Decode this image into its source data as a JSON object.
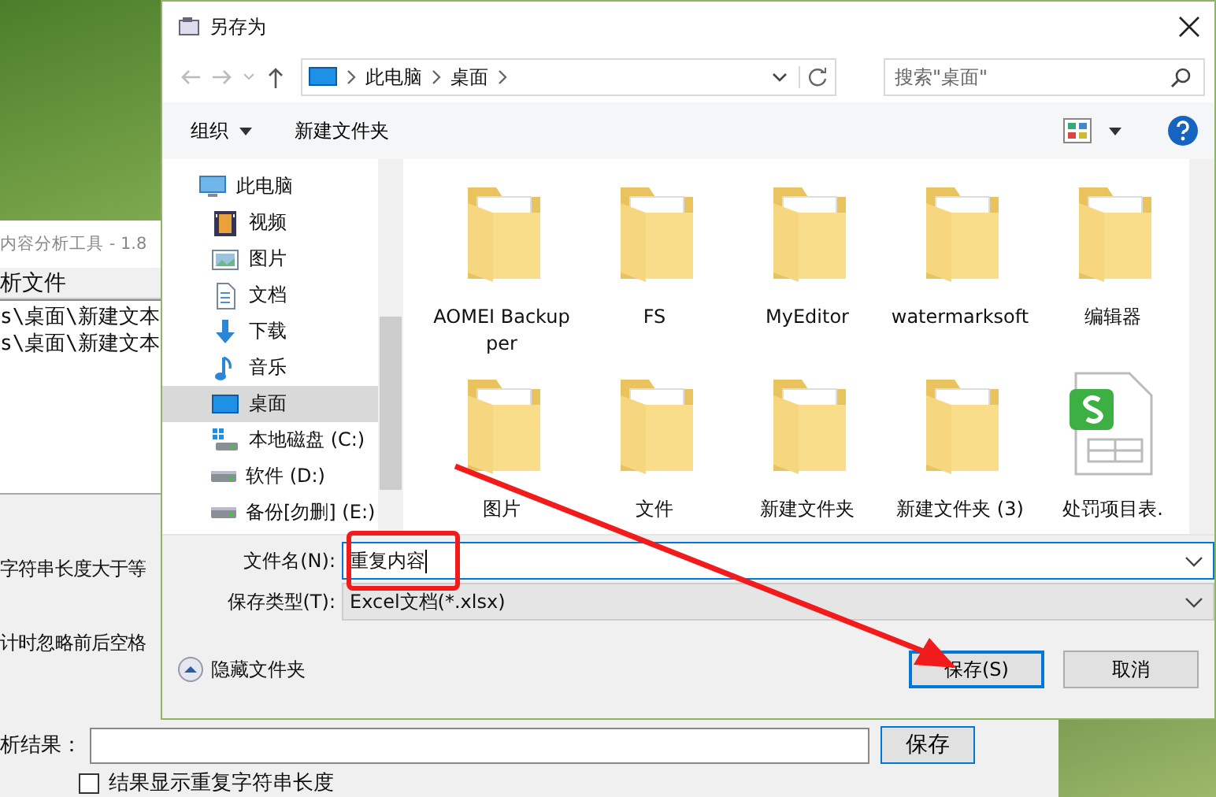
{
  "background_app": {
    "title": "内容分析工具 - 1.8",
    "group_label": "析文件",
    "file_list": [
      "s\\桌面\\新建文本",
      "s\\桌面\\新建文本"
    ],
    "options": [
      "字符串长度大于等",
      "计时忽略前后空格"
    ],
    "result_label": "析结果：",
    "save_button": "保存",
    "checkbox": {
      "label": "结果显示重复字符串长度",
      "checked": false
    }
  },
  "dialog": {
    "title": "另存为",
    "address": [
      "此电脑",
      "桌面"
    ],
    "search": {
      "placeholder": "搜索\"桌面\""
    },
    "toolbar": {
      "organize": "组织",
      "new_folder": "新建文件夹"
    },
    "nav": [
      {
        "label": "此电脑",
        "kind": "computer",
        "selected": false,
        "children": [
          {
            "label": "视频",
            "kind": "video",
            "selected": false
          },
          {
            "label": "图片",
            "kind": "pictures",
            "selected": false
          },
          {
            "label": "文档",
            "kind": "documents",
            "selected": false
          },
          {
            "label": "下载",
            "kind": "downloads",
            "selected": false
          },
          {
            "label": "音乐",
            "kind": "music",
            "selected": false
          },
          {
            "label": "桌面",
            "kind": "desktop",
            "selected": true
          },
          {
            "label": "本地磁盘 (C:)",
            "kind": "system-drive",
            "selected": false
          },
          {
            "label": "软件 (D:)",
            "kind": "drive",
            "selected": false
          },
          {
            "label": "备份[勿删] (E:)",
            "kind": "drive",
            "selected": false
          }
        ]
      }
    ],
    "files": [
      {
        "name": "AOMEI Backupper",
        "kind": "folder"
      },
      {
        "name": "FS",
        "kind": "folder"
      },
      {
        "name": "MyEditor",
        "kind": "folder"
      },
      {
        "name": "watermarksoft",
        "kind": "folder"
      },
      {
        "name": "编辑器",
        "kind": "folder"
      },
      {
        "name": "图片",
        "kind": "folder"
      },
      {
        "name": "文件",
        "kind": "folder"
      },
      {
        "name": "新建文件夹",
        "kind": "folder"
      },
      {
        "name": "新建文件夹 (3)",
        "kind": "folder"
      },
      {
        "name": "处罚项目表.",
        "kind": "spreadsheet"
      }
    ],
    "filename": {
      "label": "文件名(N):",
      "value": "重复内容"
    },
    "filetype": {
      "label": "保存类型(T):",
      "value": "Excel文档(*.xlsx)"
    },
    "hide_folders": "隐藏文件夹",
    "buttons": [
      {
        "label": "保存(S)",
        "kind": "primary"
      },
      {
        "label": "取消",
        "kind": "secondary"
      }
    ]
  }
}
